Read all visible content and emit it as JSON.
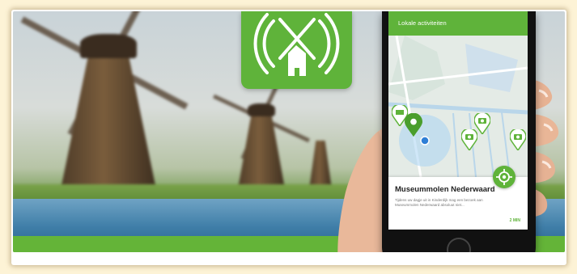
{
  "app": {
    "screen_title": "Lokale activiteiten",
    "brand_color": "#5fb33a"
  },
  "card": {
    "title": "Museummolen Nederwaard",
    "description": "Tijdens uw dagje uit in Kinderdijk mag een bezoek aan Museummolen Nederwaard absoluut niet...",
    "distance": "2 MIN"
  },
  "icons": {
    "logo": "windmill-signal-icon",
    "fab": "locate-icon",
    "pins": [
      "museum-icon",
      "camera-icon",
      "camera-icon",
      "camera-icon"
    ]
  }
}
